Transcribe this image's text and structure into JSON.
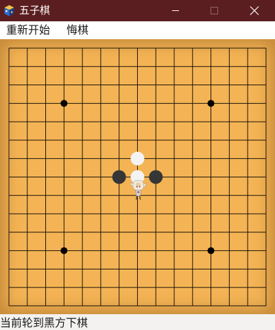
{
  "window": {
    "title": "五子棋",
    "icon": "game-cube-icon",
    "controls": [
      "minimize-icon",
      "maximize-icon",
      "close-icon"
    ]
  },
  "menu": {
    "restart_label": "重新开始",
    "undo_label": "悔棋"
  },
  "board": {
    "size": 15,
    "star_points": [
      [
        3,
        3
      ],
      [
        11,
        3
      ],
      [
        3,
        11
      ],
      [
        11,
        11
      ]
    ],
    "stones": [
      {
        "col": 6,
        "row": 7,
        "color": "black"
      },
      {
        "col": 8,
        "row": 7,
        "color": "black"
      },
      {
        "col": 7,
        "row": 6,
        "color": "white"
      },
      {
        "col": 7,
        "row": 7,
        "color": "white"
      }
    ],
    "colors": {
      "wood": "#f4b455",
      "line": "#1a1208",
      "black_stone": "#363636",
      "white_stone": "#f3f3f3"
    },
    "cursor_icon": "chibi-character-cursor-icon"
  },
  "status": {
    "text": "当前轮到黑方下棋"
  },
  "colors": {
    "titlebar": "#5b1e20",
    "menubar": "#ffffff",
    "statusbar": "#f3f2f1"
  }
}
